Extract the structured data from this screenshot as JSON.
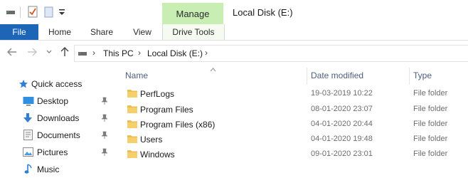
{
  "window": {
    "title": "Local Disk (E:)"
  },
  "ribbon": {
    "context_tab_group": "Manage",
    "tabs": [
      "File",
      "Home",
      "Share",
      "View",
      "Drive Tools"
    ]
  },
  "address": {
    "crumbs": [
      "This PC",
      "Local Disk (E:)"
    ]
  },
  "nav": {
    "quick_access": "Quick access",
    "items": [
      {
        "label": "Desktop",
        "icon": "desktop-icon",
        "pinned": true
      },
      {
        "label": "Downloads",
        "icon": "download-icon",
        "pinned": true
      },
      {
        "label": "Documents",
        "icon": "documents-icon",
        "pinned": true
      },
      {
        "label": "Pictures",
        "icon": "pictures-icon",
        "pinned": true
      },
      {
        "label": "Music",
        "icon": "music-icon",
        "pinned": false
      }
    ]
  },
  "list": {
    "columns": {
      "name": "Name",
      "date": "Date modified",
      "type": "Type"
    },
    "rows": [
      {
        "name": "PerfLogs",
        "date": "19-03-2019 10:22",
        "type": "File folder"
      },
      {
        "name": "Program Files",
        "date": "08-01-2020 23:07",
        "type": "File folder"
      },
      {
        "name": "Program Files (x86)",
        "date": "04-01-2020 20:44",
        "type": "File folder"
      },
      {
        "name": "Users",
        "date": "04-01-2020 19:48",
        "type": "File folder"
      },
      {
        "name": "Windows",
        "date": "09-01-2020 23:01",
        "type": "File folder"
      }
    ]
  },
  "colors": {
    "file_tab": "#1c65b7",
    "manage_tab": "#c9eeb4",
    "folder": "#e8bd54"
  }
}
